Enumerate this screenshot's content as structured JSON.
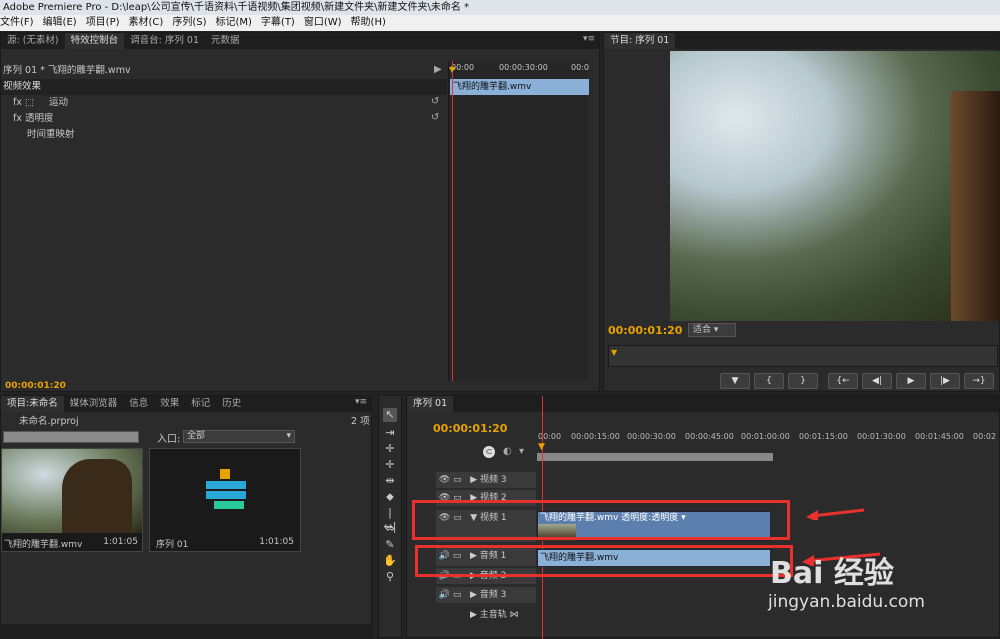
{
  "app": {
    "title": "Adobe Premiere Pro - D:\\leap\\公司宣传\\千语资料\\千语视频\\集团视频\\新建文件夹\\新建文件夹\\未命名 *"
  },
  "menu": [
    "文件(F)",
    "编辑(E)",
    "项目(P)",
    "素材(C)",
    "序列(S)",
    "标记(M)",
    "字幕(T)",
    "窗口(W)",
    "帮助(H)"
  ],
  "effects_panel": {
    "tabs": [
      "源: (无素材)",
      "特效控制台",
      "调音台: 序列 01",
      "元数据"
    ],
    "header": "序列 01 * 飞翔的雕芋翻.wmv",
    "section": "视频效果",
    "effects": [
      "运动",
      "透明度",
      "时间重映射"
    ],
    "ruler": [
      "00:00",
      "00:00:30:00",
      "00:0"
    ],
    "clip": "飞翔的雕芋翻.wmv",
    "timecode": "00:00:01:20"
  },
  "program": {
    "tab": "节目: 序列 01",
    "timecode": "00:00:01:20",
    "fit": "适合",
    "buttons": [
      "▼",
      "{",
      "}",
      "{←",
      "◀|",
      "▶",
      "|▶",
      "→}"
    ]
  },
  "project": {
    "tabs": [
      "项目:未命名",
      "媒体浏览器",
      "信息",
      "效果",
      "标记",
      "历史"
    ],
    "name": "未命名.prproj",
    "count": "2 项",
    "entry_label": "入口:",
    "entry_value": "全部",
    "items": [
      {
        "name": "飞翔的雕芋翻.wmv",
        "dur": "1:01:05"
      },
      {
        "name": "序列 01",
        "dur": "1:01:05"
      }
    ]
  },
  "timeline": {
    "tab": "序列 01",
    "timecode": "00:00:01:20",
    "ruler": [
      "00:00",
      "00:00:15:00",
      "00:00:30:00",
      "00:00:45:00",
      "00:01:00:00",
      "00:01:15:00",
      "00:01:30:00",
      "00:01:45:00",
      "00:02"
    ],
    "tracks": {
      "v3": "视频 3",
      "v2": "视频 2",
      "v1": "视频 1",
      "a1": "音频 1",
      "a2": "音频 2",
      "a3": "音频 3",
      "master": "主音轨"
    },
    "v1_clip": "飞翔的雕芋翻.wmv  透明度:透明度 ▾",
    "a1_clip": "飞翔的雕芋翻.wmv"
  },
  "watermark": {
    "brand": "Bai 经验",
    "url": "jingyan.baidu.com"
  },
  "colors": {
    "accent": "#e8a200",
    "highlight": "#e8312d",
    "clip": "#8ab0d8"
  }
}
